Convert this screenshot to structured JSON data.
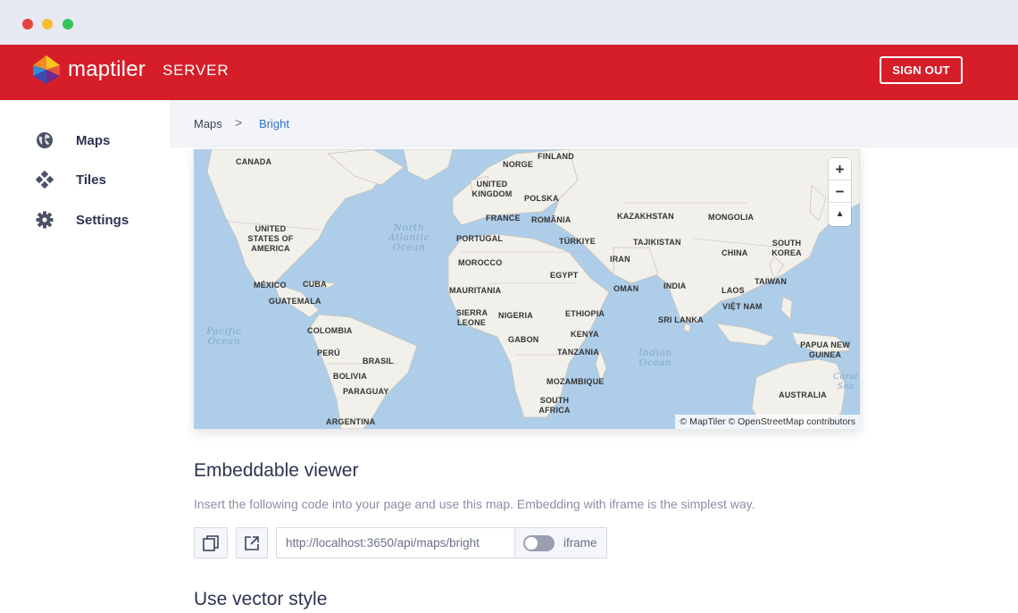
{
  "window": {
    "controls": [
      "close",
      "minimize",
      "maximize"
    ]
  },
  "header": {
    "brand_name": "maptiler",
    "brand_product": "SERVER",
    "sign_out_label": "SIGN OUT",
    "accent_color": "#d61e29"
  },
  "sidebar": {
    "items": [
      {
        "label": "Maps",
        "icon": "globe-icon"
      },
      {
        "label": "Tiles",
        "icon": "tiles-icon"
      },
      {
        "label": "Settings",
        "icon": "gear-icon"
      }
    ]
  },
  "breadcrumb": {
    "root": "Maps",
    "separator": ">",
    "current": "Bright"
  },
  "map": {
    "countries": [
      "CANADA",
      "NORGE",
      "FINLAND",
      "UNITED KINGDOM",
      "POLSKA",
      "FRANCE",
      "ROMÂNIA",
      "KAZAKHSTAN",
      "MONGOLIA",
      "UNITED STATES OF AMERICA",
      "PORTUGAL",
      "TÜRKIYE",
      "TAJIKISTAN",
      "CHINA",
      "SOUTH KOREA",
      "MOROCCO",
      "IRAN",
      "EGYPT",
      "MÉXICO",
      "CUBA",
      "MAURITANIA",
      "OMAN",
      "INDIA",
      "LAOS",
      "TAIWAN",
      "GUATEMALA",
      "SIERRA LEONE",
      "NIGERIA",
      "ETHIOPIA",
      "VIỆT NAM",
      "SRI LANKA",
      "COLOMBIA",
      "KENYA",
      "GABON",
      "PERÚ",
      "BRASIL",
      "TANZANIA",
      "PAPUA NEW GUINEA",
      "BOLIVIA",
      "MOZAMBIQUE",
      "PARAGUAY",
      "SOUTH AFRICA",
      "AUSTRALIA",
      "ARGENTINA"
    ],
    "oceans": [
      "North Atlantic Ocean",
      "Pacific Ocean",
      "Indian Ocean",
      "Coral Sea"
    ],
    "zoom_in": "+",
    "zoom_out": "−",
    "compass": "▲",
    "attribution": "© MapTiler © OpenStreetMap contributors"
  },
  "embed": {
    "title": "Embeddable viewer",
    "description": "Insert the following code into your page and use this map. Embedding with iframe is the simplest way.",
    "url": "http://localhost:3650/api/maps/bright",
    "toggle_label": "iframe",
    "toggle_on": false
  },
  "vector": {
    "title": "Use vector style"
  }
}
